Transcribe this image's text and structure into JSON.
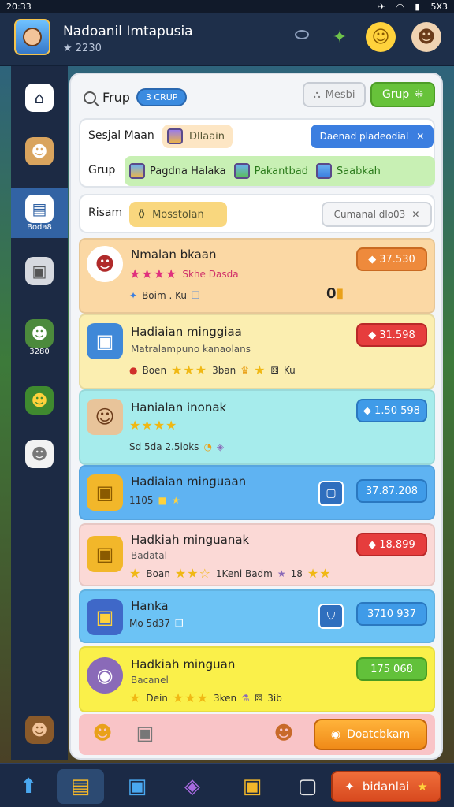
{
  "status": {
    "time": "20:33",
    "right": "5X3"
  },
  "header": {
    "name": "Nadoanil Imtapusia",
    "score": "★ 2230"
  },
  "sidebar": {
    "active_label": "Boda8",
    "coins": "3280"
  },
  "panel": {
    "title": "Frup",
    "title_pill": "3 CRUP",
    "btn_light": "Mesbi",
    "btn_green": "Grup",
    "filter_label_1": "Sesjal Maan",
    "filter_chip": "Dllaain",
    "filter_btn": "Daenad pladeodial",
    "filter_label_2": "Grup",
    "green_opts": [
      "Pagdna Halaka",
      "Pakantbad",
      "Saabkah"
    ],
    "sort_label": "Risam",
    "sort_chip": "Mosstolan",
    "sort_btn": "Cumanal dlo03"
  },
  "rows": [
    {
      "title": "Nmalan bkaan",
      "stars_text": "Skhe Dasda",
      "meta": "Boim . Ku",
      "price": "37.530",
      "badge": "0"
    },
    {
      "title": "Hadiaian minggiaa",
      "sub": "Matralampuno kanaolans",
      "meta": "Boen",
      "meta2": "3ban",
      "meta3": "Ku",
      "price": "31.598"
    },
    {
      "title": "Hanialan inonak",
      "meta": "Sd 5da  2.5ioks",
      "price": "1.50 598"
    },
    {
      "title": "Hadiaian minguaan",
      "meta": "1105",
      "price": "37.87.208"
    },
    {
      "title": "Hadkiah minguanak",
      "sub": "Badatal",
      "meta": "Boan",
      "meta2": "1Keni Badm",
      "meta3": "18",
      "price": "18.899"
    },
    {
      "title": "Hanka",
      "meta": "Mo 5d37",
      "price": "3710 937"
    },
    {
      "title": "Hadkiah minguan",
      "sub": "Bacanel",
      "meta": "Dein",
      "meta2": "3ken",
      "meta3": "3ib",
      "price": "175 068"
    }
  ],
  "footer": {
    "button": "Doatcbkam"
  },
  "bottom_nav": {
    "wide_button": "bidanlai"
  },
  "colors": {
    "accent_green": "#67c23a",
    "accent_blue": "#3b7ee0",
    "accent_orange": "#ee8a3c"
  }
}
